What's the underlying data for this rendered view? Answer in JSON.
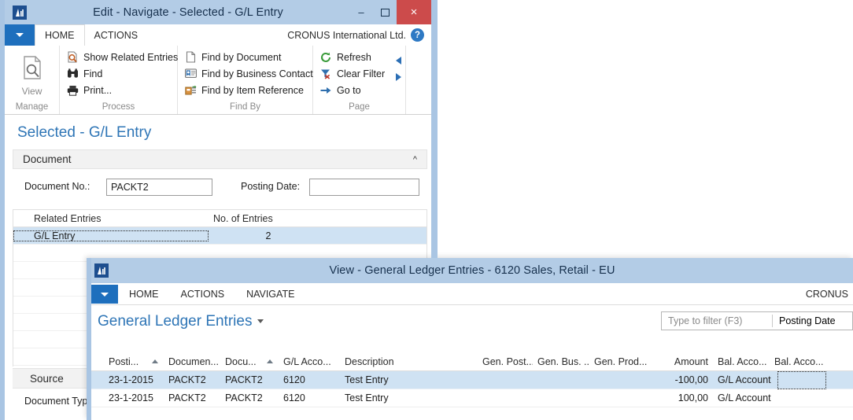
{
  "navigate_window": {
    "title": "Edit - Navigate - Selected - G/L Entry",
    "icon": "dynamics-nav-icon",
    "window_buttons": {
      "minimize": "–",
      "maximize": "❑",
      "close": "×"
    },
    "ribbon": {
      "app_menu": "app-menu-caret",
      "tabs": [
        {
          "label": "HOME",
          "active": true
        },
        {
          "label": "ACTIONS",
          "active": false
        }
      ],
      "company": "CRONUS International Ltd.",
      "help": "?",
      "groups": [
        {
          "name": "Manage",
          "label": "Manage",
          "big_button": {
            "label": "View",
            "icon": "page-search-icon"
          }
        },
        {
          "name": "Process",
          "label": "Process",
          "items": [
            {
              "label": "Show Related Entries",
              "icon": "related-entries-icon"
            },
            {
              "label": "Find",
              "icon": "binoculars-icon"
            },
            {
              "label": "Print...",
              "icon": "printer-icon"
            }
          ]
        },
        {
          "name": "FindBy",
          "label": "Find By",
          "items": [
            {
              "label": "Find by Document",
              "icon": "document-icon"
            },
            {
              "label": "Find by Business Contact",
              "icon": "contact-card-icon"
            },
            {
              "label": "Find by Item Reference",
              "icon": "item-reference-icon"
            }
          ]
        },
        {
          "name": "Page",
          "label": "Page",
          "items": [
            {
              "label": "Refresh",
              "icon": "refresh-icon"
            },
            {
              "label": "Clear Filter",
              "icon": "clear-filter-icon"
            },
            {
              "label": "Go to",
              "icon": "arrow-right-icon"
            }
          ],
          "nav_prev": "previous-arrow-icon",
          "nav_next": "next-arrow-icon"
        }
      ]
    },
    "page_title": "Selected - G/L Entry",
    "fastgroup": {
      "label": "Document",
      "collapse_icon": "chevron-up-icon"
    },
    "fields": [
      {
        "label": "Document No.:",
        "value": "PACKT2"
      },
      {
        "label": "Posting Date:",
        "value": ""
      }
    ],
    "related_grid": {
      "columns": [
        "Related Entries",
        "No. of Entries"
      ],
      "rows": [
        {
          "related": "G/L Entry",
          "count": "2",
          "selected": true
        },
        {
          "related": "",
          "count": "",
          "selected": false
        },
        {
          "related": "",
          "count": "",
          "selected": false
        },
        {
          "related": "",
          "count": "",
          "selected": false
        },
        {
          "related": "",
          "count": "",
          "selected": false
        },
        {
          "related": "",
          "count": "",
          "selected": false
        },
        {
          "related": "",
          "count": "",
          "selected": false
        }
      ]
    },
    "source_section": {
      "label": "Source",
      "field_label": "Document Typ"
    }
  },
  "gl_window": {
    "title": "View - General Ledger Entries - 6120 Sales, Retail - EU",
    "icon": "dynamics-nav-icon",
    "ribbon": {
      "app_menu": "app-menu-caret",
      "tabs": [
        {
          "label": "HOME",
          "active": false
        },
        {
          "label": "ACTIONS",
          "active": false
        },
        {
          "label": "NAVIGATE",
          "active": false
        }
      ],
      "company": "CRONUS"
    },
    "page_title": "General Ledger Entries",
    "page_title_caret": "chevron-down-icon",
    "filter": {
      "placeholder": "Type to filter (F3)",
      "field": "Posting Date"
    },
    "grid": {
      "columns": [
        {
          "label": "Posti...",
          "sorted": true,
          "align": "left"
        },
        {
          "label": "Documen...",
          "sorted": false,
          "align": "left"
        },
        {
          "label": "Docu...",
          "sorted": true,
          "align": "left"
        },
        {
          "label": "G/L Acco...",
          "sorted": false,
          "align": "left"
        },
        {
          "label": "Description",
          "sorted": false,
          "align": "left"
        },
        {
          "label": "Gen. Post...",
          "sorted": false,
          "align": "left"
        },
        {
          "label": "Gen. Bus. ...",
          "sorted": false,
          "align": "left"
        },
        {
          "label": "Gen. Prod...",
          "sorted": false,
          "align": "left"
        },
        {
          "label": "Amount",
          "sorted": false,
          "align": "right"
        },
        {
          "label": "Bal. Acco...",
          "sorted": false,
          "align": "left"
        },
        {
          "label": "Bal. Acco...",
          "sorted": false,
          "align": "left"
        }
      ],
      "rows": [
        {
          "selected": true,
          "posting_date": "23-1-2015",
          "document_no": "PACKT2",
          "document_no2": "PACKT2",
          "gl_account": "6120",
          "description": "Test Entry",
          "gen_posting": "",
          "gen_bus": "",
          "gen_prod": "",
          "amount": "-100,00",
          "bal_acc_type": "G/L Account",
          "bal_acc_no": ""
        },
        {
          "selected": false,
          "posting_date": "23-1-2015",
          "document_no": "PACKT2",
          "document_no2": "PACKT2",
          "gl_account": "6120",
          "description": "Test Entry",
          "gen_posting": "",
          "gen_bus": "",
          "gen_prod": "",
          "amount": "100,00",
          "bal_acc_type": "G/L Account",
          "bal_acc_no": ""
        }
      ]
    }
  },
  "colors": {
    "titlebar": "#b3cce6",
    "accent_blue": "#1e6fbd",
    "close_red": "#cc4b4b",
    "selection": "#cfe2f3",
    "page_title_blue": "#2e75b6"
  }
}
